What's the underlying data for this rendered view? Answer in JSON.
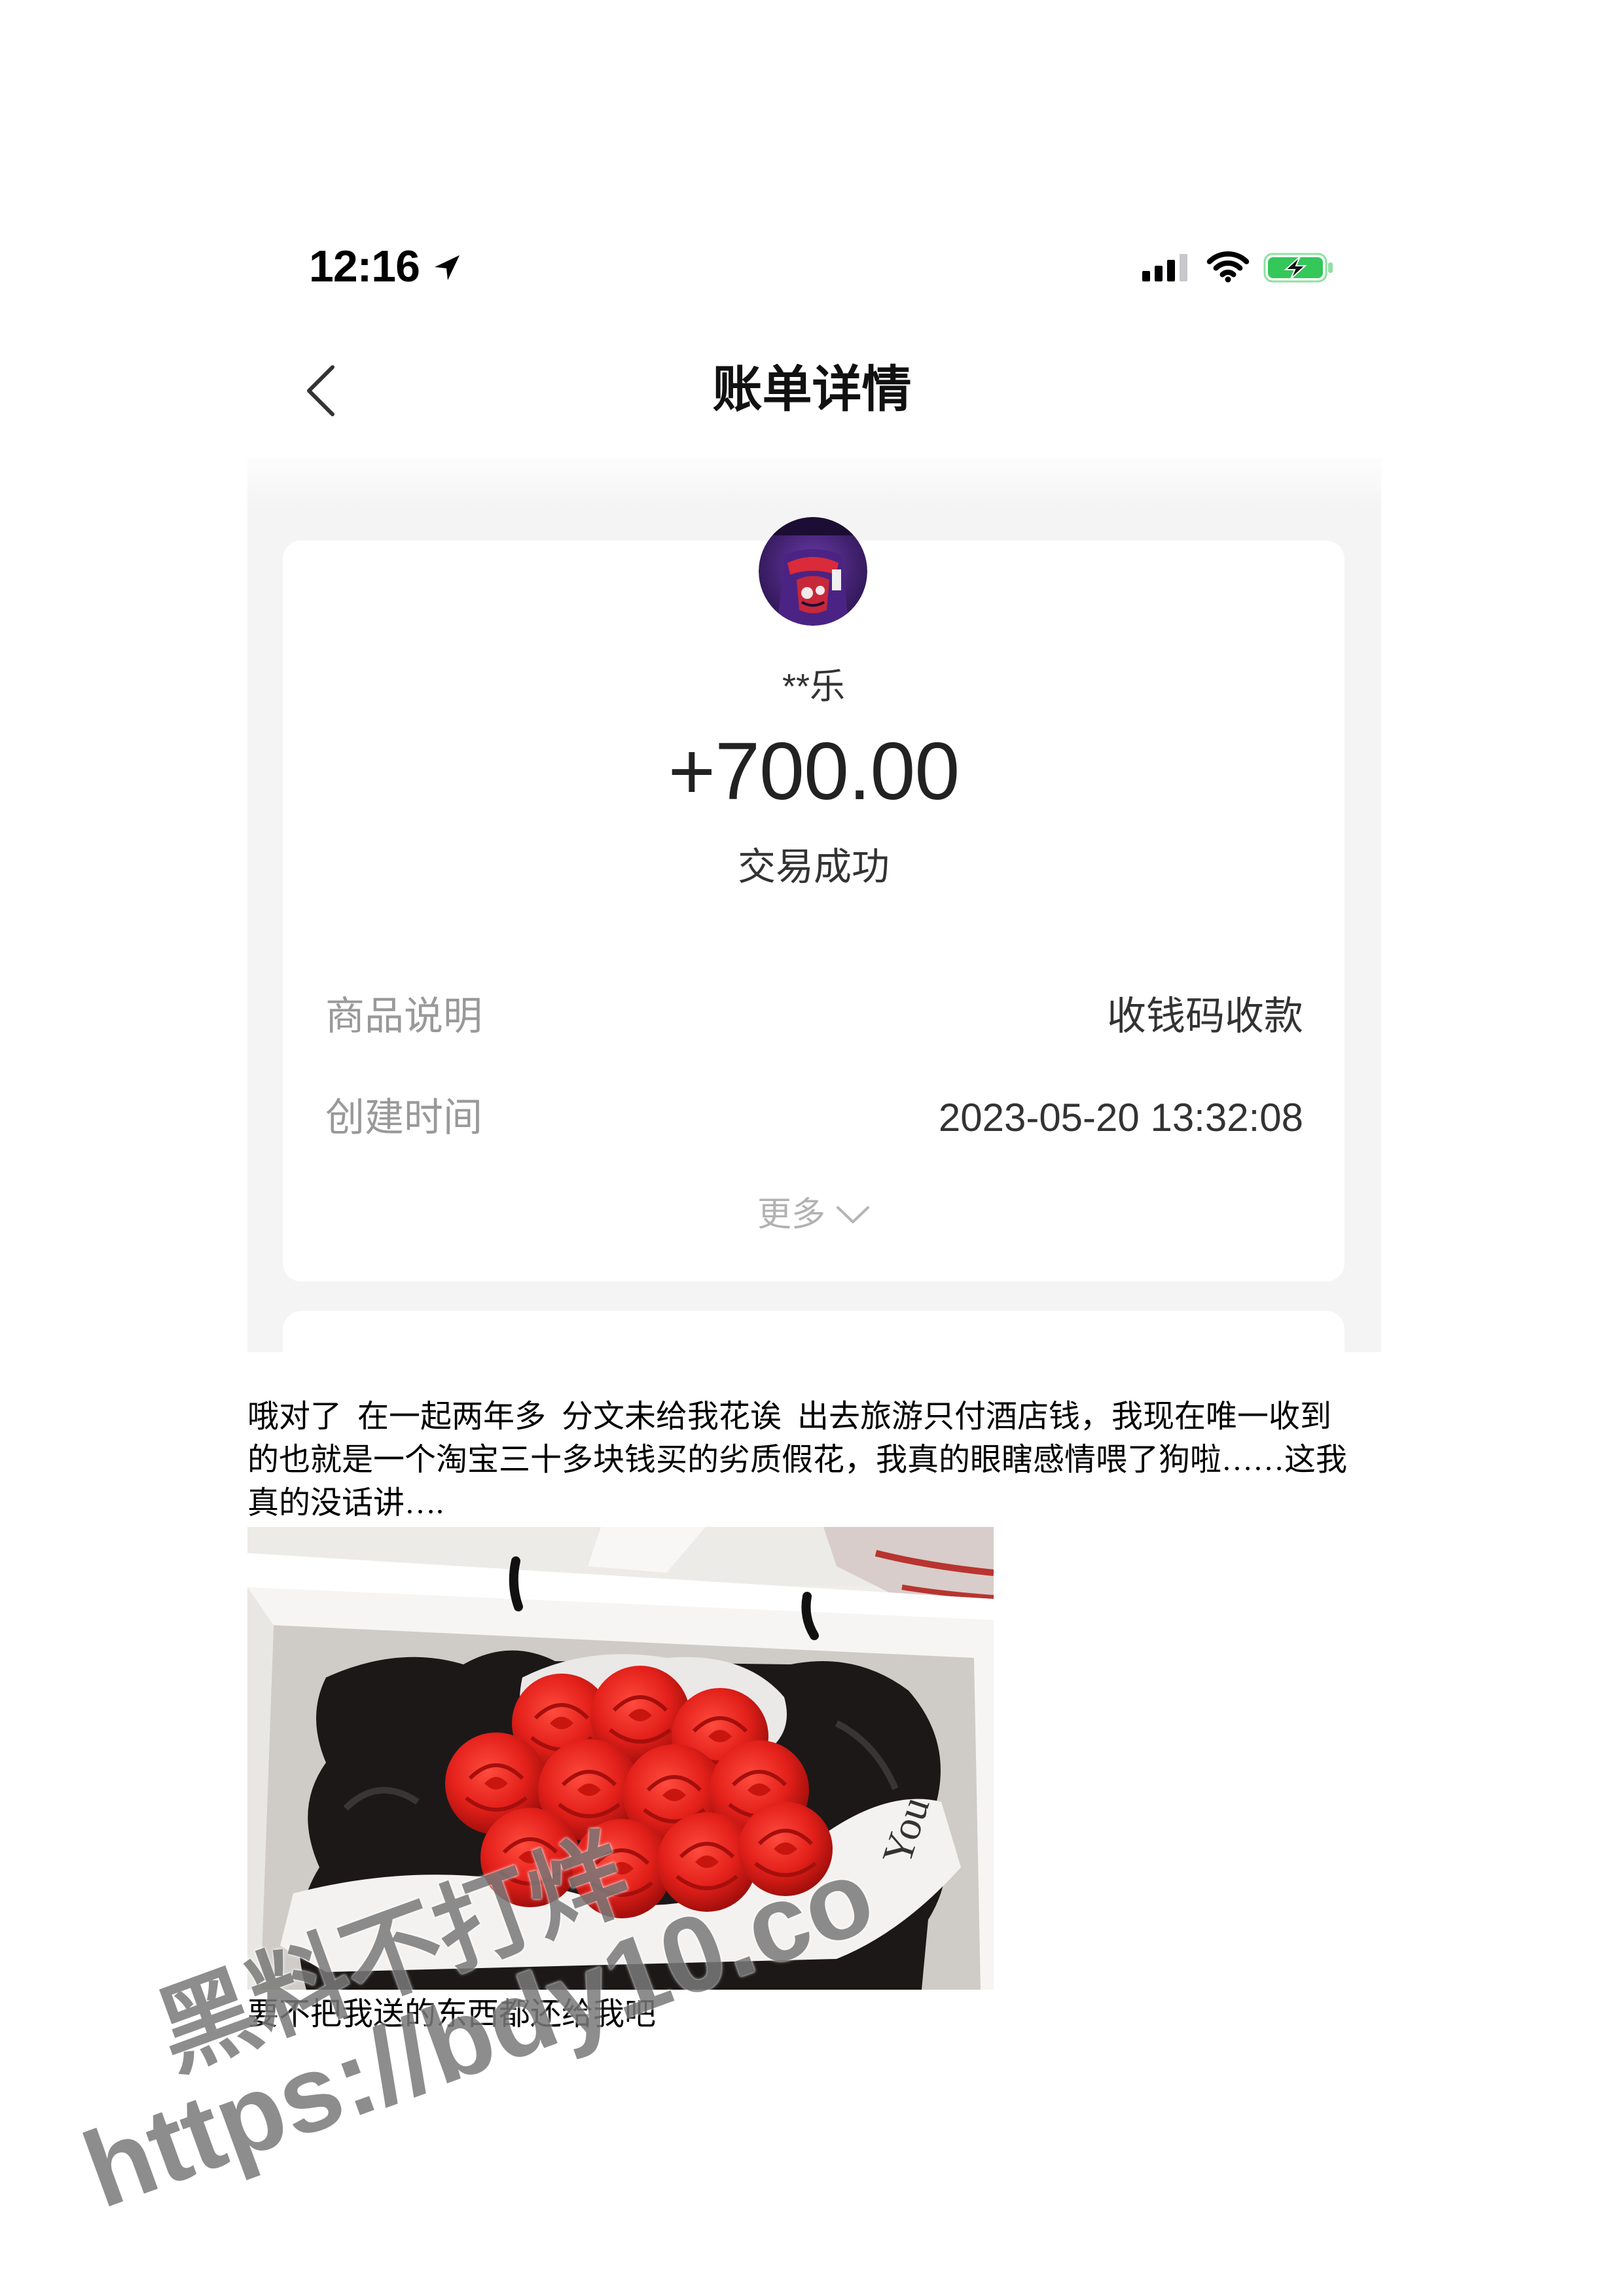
{
  "status_bar": {
    "time": "12:16",
    "icons": {
      "location": "location-arrow-icon",
      "signal": "cellular-signal-icon",
      "wifi": "wifi-icon",
      "battery": "battery-charging-icon"
    }
  },
  "nav": {
    "back_icon": "chevron-left-icon",
    "title": "账单详情"
  },
  "bill": {
    "avatar_icon": "avatar",
    "payer_name": "**乐",
    "amount": "+700.00",
    "status": "交易成功",
    "rows": [
      {
        "label": "商品说明",
        "value": "收钱码收款"
      },
      {
        "label": "创建时间",
        "value": "2023-05-20 13:32:08"
      }
    ],
    "more_label": "更多",
    "more_icon": "chevron-down-icon"
  },
  "post": {
    "paragraph_lines": [
      "哦对了  在一起两年多  分文未给我花诶  出去旅游只付酒店钱，我现在唯一收到",
      "的也就是一个淘宝三十多块钱买的劣质假花，我真的眼瞎感情喂了狗啦……这我",
      "真的没话讲…."
    ],
    "photo_print": "You",
    "caption": "要不把我送的东西都还给我吧"
  },
  "watermark": {
    "line1": "黑料不打烊",
    "line2": "https://bdy10.co"
  },
  "colors": {
    "panel_bg": "#f4f4f4",
    "card_bg": "#ffffff",
    "label_gray": "#999999",
    "value_text": "#333333",
    "more_gray": "#b2b2b2",
    "battery_green": "#34c759",
    "rose_red": "#e3201a",
    "watermark_gray": "#7a7a7a"
  }
}
